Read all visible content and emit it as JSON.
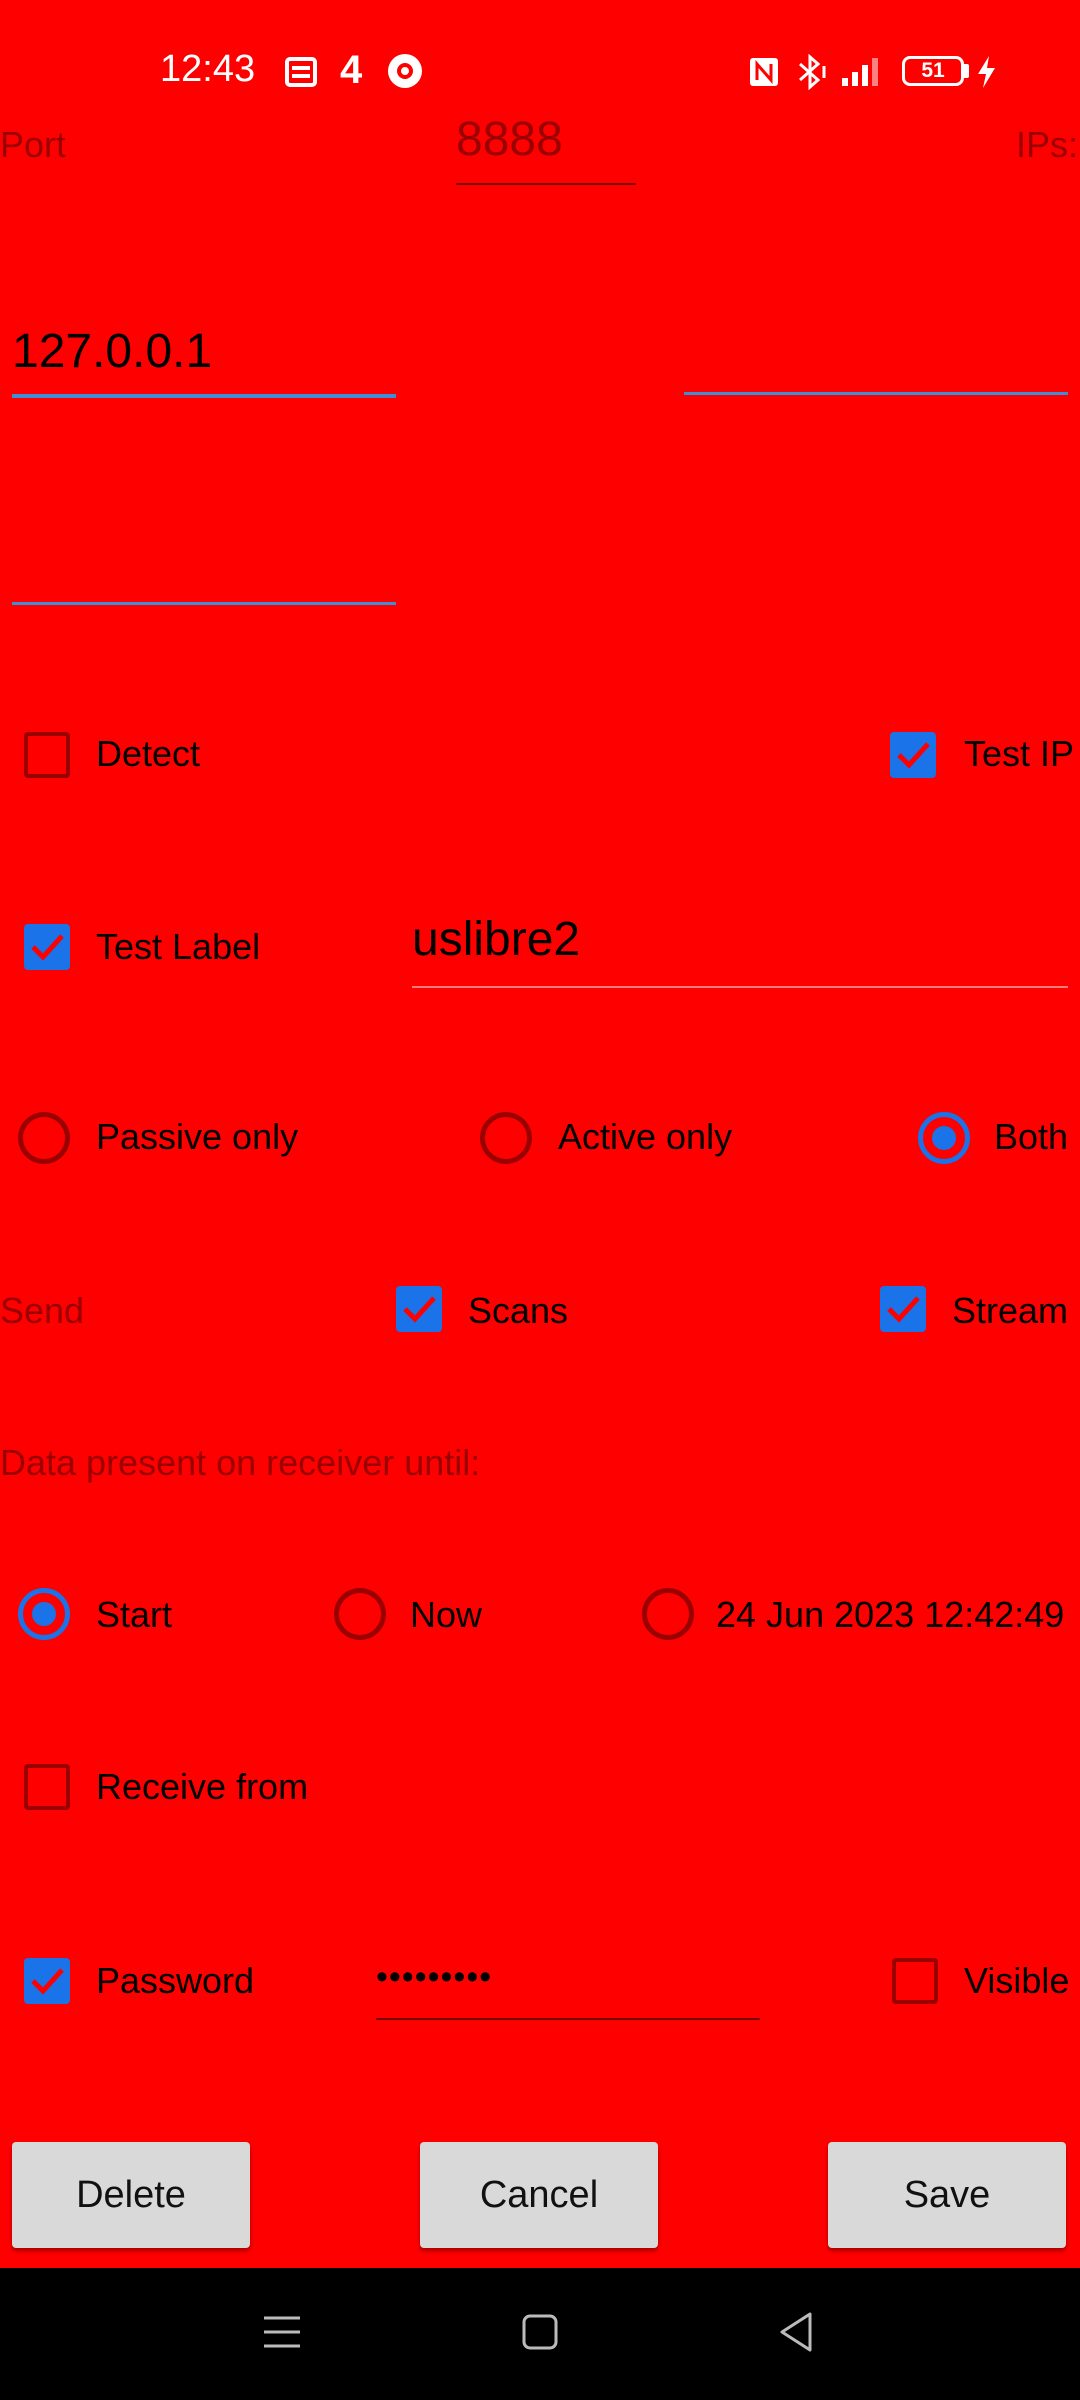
{
  "status_bar": {
    "time": "12:43",
    "notification_count": "4",
    "battery_level": "51",
    "icons": [
      "sim-card-icon",
      "record-icon",
      "nfc-icon",
      "bluetooth-icon",
      "signal-icon",
      "battery-icon",
      "charging-icon"
    ]
  },
  "connection": {
    "port_label": "Port",
    "port_value": "8888",
    "ips_label": "IPs:",
    "ip1_value": "127.0.0.1",
    "ip2_value": "",
    "ip3_value": ""
  },
  "options": {
    "detect_label": "Detect",
    "detect_checked": false,
    "test_ip_label": "Test IP",
    "test_ip_checked": true,
    "test_label_label": "Test Label",
    "test_label_checked": true,
    "label_value": "uslibre2"
  },
  "mode": {
    "passive_label": "Passive only",
    "active_label": "Active only",
    "both_label": "Both",
    "selected": "Both"
  },
  "send": {
    "send_label": "Send",
    "scans_label": "Scans",
    "scans_checked": true,
    "stream_label": "Stream",
    "stream_checked": true
  },
  "data_until": {
    "heading": "Data present on receiver until:",
    "start_label": "Start",
    "now_label": "Now",
    "date_label": "24 Jun 2023 12:42:49",
    "selected": "Start"
  },
  "receive": {
    "receive_from_label": "Receive from",
    "receive_from_checked": false
  },
  "password": {
    "label": "Password",
    "checked": true,
    "value": "•••••••••",
    "visible_label": "Visible",
    "visible_checked": false
  },
  "buttons": {
    "delete_label": "Delete",
    "cancel_label": "Cancel",
    "save_label": "Save"
  },
  "colors": {
    "background": "#ff0000",
    "accent": "#1a73e8",
    "muted": "#9a0000",
    "button": "#d9d9d9",
    "navbar": "#000000"
  }
}
